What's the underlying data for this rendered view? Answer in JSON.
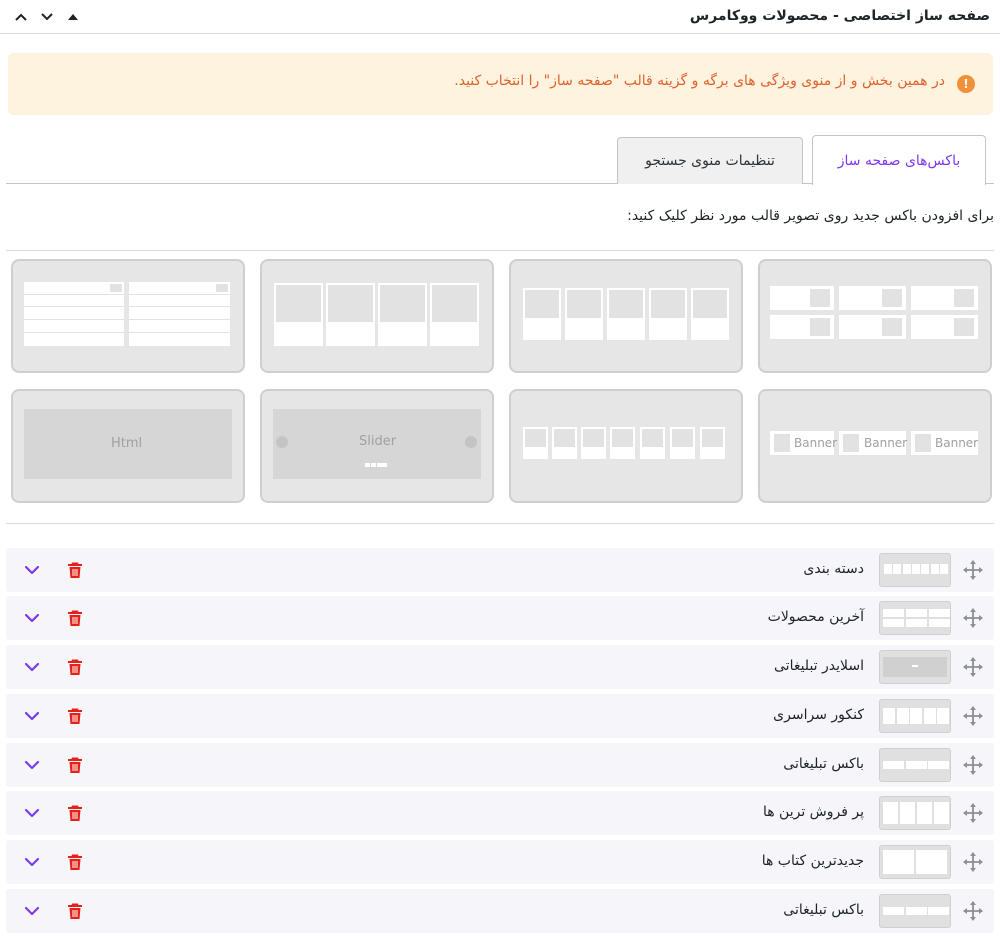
{
  "header": {
    "title": "صفحه ساز اختصاصی - محصولات ووکامرس",
    "controls": [
      "chevron-up-icon",
      "chevron-down-icon",
      "collapse-caret-up-icon"
    ]
  },
  "notice": {
    "icon": "exclamation-icon",
    "text": "در همین بخش و از منوی ویژگی های برگه و گزینه قالب \"صفحه ساز\" را انتخاب کنید."
  },
  "tabs": [
    {
      "label": "باکس‌های صفحه ساز",
      "active": true
    },
    {
      "label": "تنظیمات منوی جستجو",
      "active": false
    }
  ],
  "hint": "برای افزودن باکس جدید روی تصویر قالب مورد نظر کلیک کنید:",
  "templates": {
    "banner_label": "Banner",
    "slider_label": "Slider",
    "html_label": "Html"
  },
  "boxes": [
    {
      "name": "دسته بندی",
      "thumb": "categories"
    },
    {
      "name": "آخرین محصولات",
      "thumb": "grid"
    },
    {
      "name": "اسلایدر تبلیغاتی",
      "thumb": "slider"
    },
    {
      "name": "کنکور سراسری",
      "thumb": "five"
    },
    {
      "name": "باکس تبلیغاتی",
      "thumb": "banner"
    },
    {
      "name": "پر فروش ترین ها",
      "thumb": "four"
    },
    {
      "name": "جدیدترین کتاب ها",
      "thumb": "list"
    },
    {
      "name": "باکس تبلیغاتی",
      "thumb": "banner"
    }
  ],
  "colors": {
    "accent": "#7c3aed",
    "trash": "#e5211a",
    "notice_bg": "#fdf3df",
    "notice_text": "#e0612b"
  }
}
